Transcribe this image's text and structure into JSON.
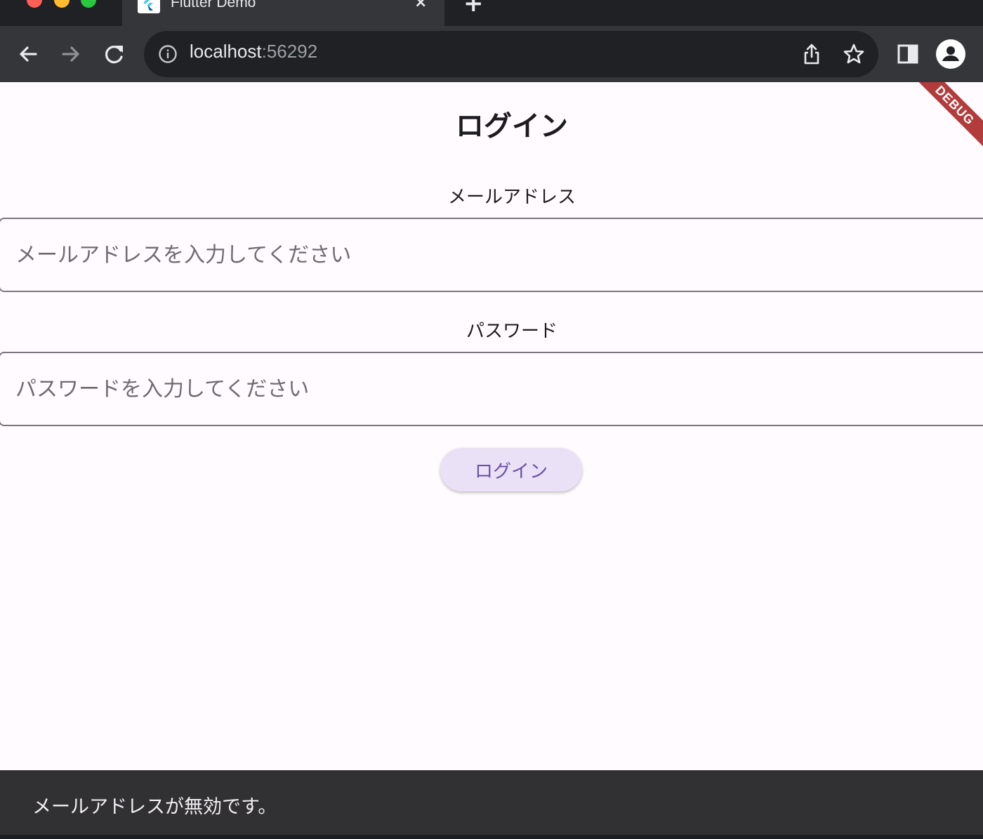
{
  "browser": {
    "tab_title": "Flutter Demo",
    "tab_close": "×",
    "new_tab": "+",
    "url_host": "localhost",
    "url_port": ":56292"
  },
  "page": {
    "title": "ログイン",
    "debug_ribbon": "DEBUG",
    "email": {
      "label": "メールアドレス",
      "placeholder": "メールアドレスを入力してください",
      "value": ""
    },
    "password": {
      "label": "パスワード",
      "placeholder": "パスワードを入力してください",
      "value": ""
    },
    "login_button": "ログイン"
  },
  "snackbar": {
    "message": "メールアドレスが無効です。"
  },
  "colors": {
    "primary": "#6750a4",
    "button_bg": "#ebe1f6",
    "page_bg": "#fffbfe",
    "snackbar_bg": "#313033",
    "browser_chrome": "#35363a"
  }
}
